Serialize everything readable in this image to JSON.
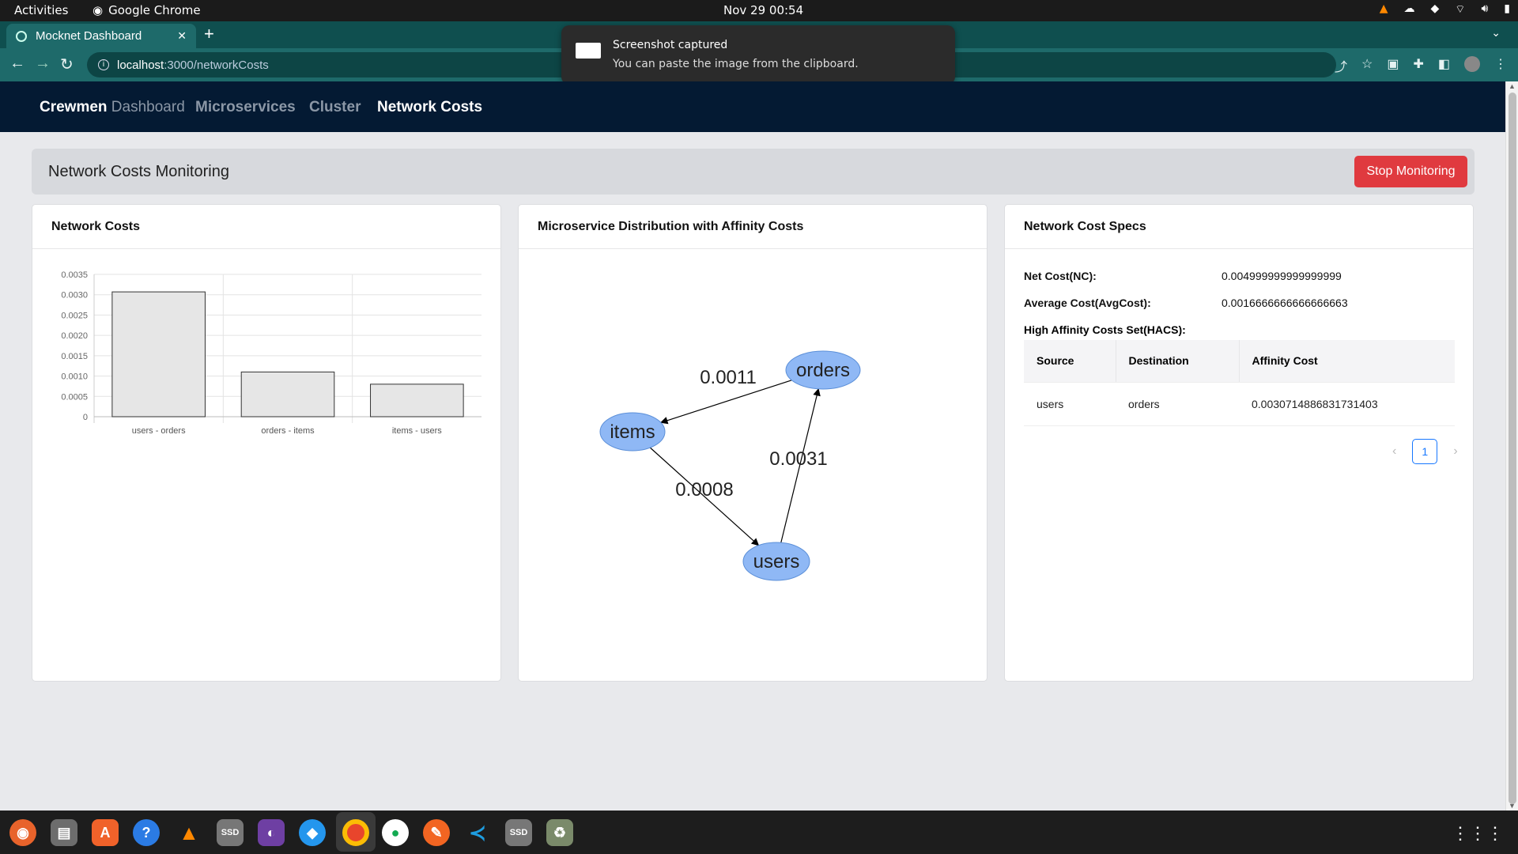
{
  "system": {
    "activities": "Activities",
    "app_name": "Google Chrome",
    "clock": "Nov 29  00:54"
  },
  "browser": {
    "tab_title": "Mocknet Dashboard",
    "url_host": "localhost",
    "url_path": ":3000/networkCosts"
  },
  "notification": {
    "title": "Screenshot captured",
    "body": "You can paste the image from the clipboard."
  },
  "nav": {
    "brand_bold": "Crewmen",
    "brand_light": " Dashboard",
    "links": [
      "Microservices",
      "Cluster",
      "Network Costs"
    ]
  },
  "header": {
    "title": "Network Costs Monitoring",
    "stop_button": "Stop Monitoring"
  },
  "cards": {
    "network_costs_title": "Network Costs",
    "distribution_title": "Microservice Distribution with Affinity Costs",
    "specs_title": "Network Cost Specs"
  },
  "chart_data": {
    "type": "bar",
    "categories": [
      "users - orders",
      "orders - items",
      "items - users"
    ],
    "values": [
      0.00307,
      0.0011,
      0.0008
    ],
    "ylim": [
      0,
      0.0035
    ],
    "yticks": [
      "0",
      "0.0005",
      "0.0010",
      "0.0015",
      "0.0020",
      "0.0025",
      "0.0030",
      "0.0035"
    ],
    "title": "",
    "xlabel": "",
    "ylabel": "",
    "grid": true,
    "bar_color": "#e6e6e6"
  },
  "graph": {
    "nodes": [
      "orders",
      "items",
      "users"
    ],
    "edges": [
      {
        "from": "orders",
        "to": "items",
        "label": "0.0011"
      },
      {
        "from": "users",
        "to": "orders",
        "label": "0.0031"
      },
      {
        "from": "items",
        "to": "users",
        "label": "0.0008"
      }
    ],
    "node_color": "#8fb8f5"
  },
  "specs": {
    "net_cost_label": "Net Cost(NC):",
    "net_cost_value": "0.004999999999999999",
    "avg_cost_label": "Average Cost(AvgCost):",
    "avg_cost_value": "0.0016666666666666663",
    "hacs_label": "High Affinity Costs Set(HACS):",
    "columns": [
      "Source",
      "Destination",
      "Affinity Cost"
    ],
    "rows": [
      [
        "users",
        "orders",
        "0.0030714886831731403"
      ]
    ],
    "page": "1"
  },
  "colors": {
    "navbar": "#041a33",
    "stop_button": "#e03a3f",
    "tab_strip": "#0f4f4f"
  }
}
